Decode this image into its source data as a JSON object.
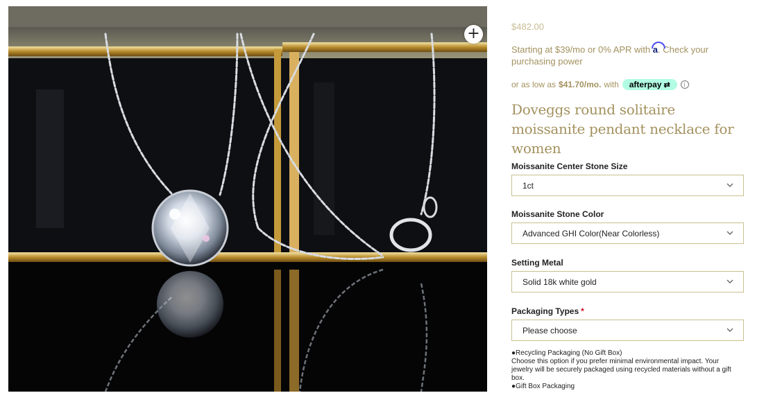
{
  "product": {
    "price": "$482.00",
    "affirm_prefix": "Starting at $39/mo or 0% APR with",
    "affirm_logo": "a",
    "affirm_suffix": ". Check your purchasing power",
    "afterpay_prefix": "or as low as",
    "afterpay_amount": "$41.70/mo.",
    "afterpay_with": "with",
    "afterpay_logo": "afterpay",
    "title": "Doveggs round solitaire moissanite pendant necklace for women",
    "image_icon": "zoom-plus-icon"
  },
  "options": [
    {
      "label": "Moissanite Center Stone Size",
      "value": "1ct",
      "required": false
    },
    {
      "label": "Moissanite Stone Color",
      "value": "Advanced GHI Color(Near Colorless)",
      "required": false
    },
    {
      "label": "Setting Metal",
      "value": "Solid 18k white gold",
      "required": false
    },
    {
      "label": "Packaging Types",
      "value": "Please choose",
      "required": true,
      "required_mark": "*"
    }
  ],
  "packaging_notes": {
    "option1_title": "●Recycling Packaging (No Gift Box)",
    "option1_desc": "Choose this option if you prefer minimal environmental impact. Your jewelry will be securely packaged using recycled materials without a gift box.",
    "option2_title": "●Gift Box Packaging"
  },
  "colors": {
    "gold_text": "#a3915e",
    "border": "#c9bf8f",
    "afterpay_mint": "#b2fce4",
    "required": "#d0021b"
  }
}
